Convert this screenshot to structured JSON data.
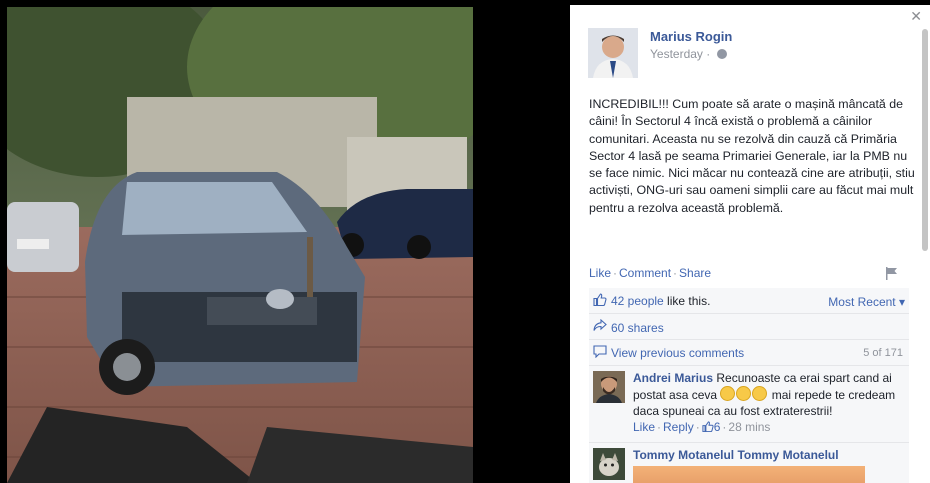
{
  "post": {
    "author": "Marius Rogin",
    "time": "Yesterday",
    "time_sep": "·",
    "text": "INCREDIBIL!!! Cum poate să arate o mașină mâncată de câini! În Sectorul 4 încă există o problemă a câinilor comunitari. Aceasta nu se rezolvă din cauză că Primăria Sector 4 lasă pe seama Primariei Generale, iar la PMB nu se face nimic. Nici măcar nu contează cine are atribuții, stiu activiști, ONG-uri sau oameni simplii care au făcut mai mult pentru a rezolva această problemă."
  },
  "actions": {
    "like": "Like",
    "comment": "Comment",
    "share": "Share",
    "sep": "·"
  },
  "ufi": {
    "likes_link": "42 people",
    "likes_suffix": " like this.",
    "most_recent": "Most Recent ▾",
    "shares": "60 shares",
    "view_previous": "View previous comments",
    "comment_count": "5 of 171"
  },
  "comments": [
    {
      "author": "Andrei Marius",
      "text_a": "Recunoaste ca erai spart cand ai postat asa ceva ",
      "text_b": " mai repede te credeam daca spuneai ca au fost extraterestrii!",
      "like": "Like",
      "reply": "Reply",
      "likes": "6",
      "time": "28 mins",
      "sep": "·"
    },
    {
      "author": "Tommy Motanelul Tommy Motanelul"
    }
  ],
  "icons": {
    "close": "close-icon",
    "globe": "globe-icon",
    "flag": "flag-icon",
    "like": "thumbs-up-icon",
    "share": "share-arrow-icon",
    "comment": "comment-bubble-icon"
  },
  "colors": {
    "link": "#4267b2",
    "author": "#3b5998",
    "muted": "#90949c",
    "ufi_bg": "#f6f7f9"
  }
}
